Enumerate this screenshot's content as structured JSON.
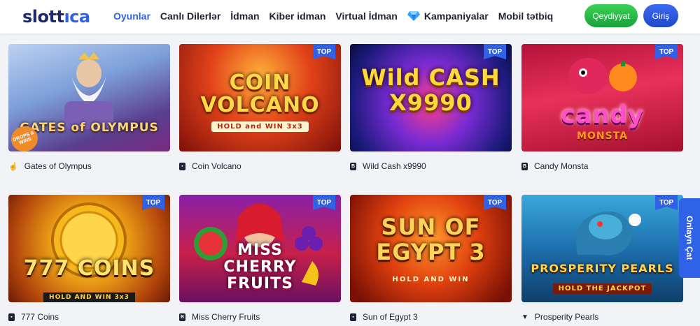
{
  "header": {
    "logo_main": "slott",
    "logo_accent": "ıca",
    "nav": [
      {
        "label": "Oyunlar"
      },
      {
        "label": "Canlı Dilerlər"
      },
      {
        "label": "İdman"
      },
      {
        "label": "Kiber idman"
      },
      {
        "label": "Virtual İdman"
      },
      {
        "label": "Kampaniyalar"
      },
      {
        "label": "Mobil tətbiq"
      }
    ],
    "register_label": "Qeydiyyat",
    "login_label": "Giriş"
  },
  "badge_label": "TOP",
  "games": [
    {
      "name": "Gates of Olympus",
      "art": "GATES of OLYMPUS",
      "art_sub": "DROPS & WINS",
      "provider_icon": "hand-icon",
      "top": false
    },
    {
      "name": "Coin Volcano",
      "art": "COIN VOLCANO",
      "art_sub": "HOLD and WIN 3x3",
      "provider_icon": "card-icon",
      "top": true
    },
    {
      "name": "Wild Cash x9990",
      "art": "Wild CASH X9990",
      "art_sub": "",
      "provider_icon": "b-icon",
      "top": true
    },
    {
      "name": "Candy Monsta",
      "art": "candy",
      "art_sub": "MONSTA",
      "provider_icon": "b-icon",
      "top": true
    },
    {
      "name": "777 Coins",
      "art": "777 COINS",
      "art_sub": "HOLD AND WIN 3x3",
      "provider_icon": "card-icon",
      "top": true
    },
    {
      "name": "Miss Cherry Fruits",
      "art": "MISS CHERRY FRUITS",
      "art_sub": "",
      "provider_icon": "b-icon",
      "top": true
    },
    {
      "name": "Sun of Egypt 3",
      "art": "SUN OF EGYPT 3",
      "art_sub": "HOLD AND WIN",
      "provider_icon": "card-icon",
      "top": true
    },
    {
      "name": "Prosperity Pearls",
      "art": "PROSPERITY PEARLS",
      "art_sub": "HOLD THE JACKPOT",
      "provider_icon": "chevron-icon",
      "top": true
    }
  ],
  "chat_label": "Onlayn Çat",
  "colors": {
    "accent": "#2f62e6",
    "register": "#2bbf48",
    "background": "#f2f3f7"
  }
}
